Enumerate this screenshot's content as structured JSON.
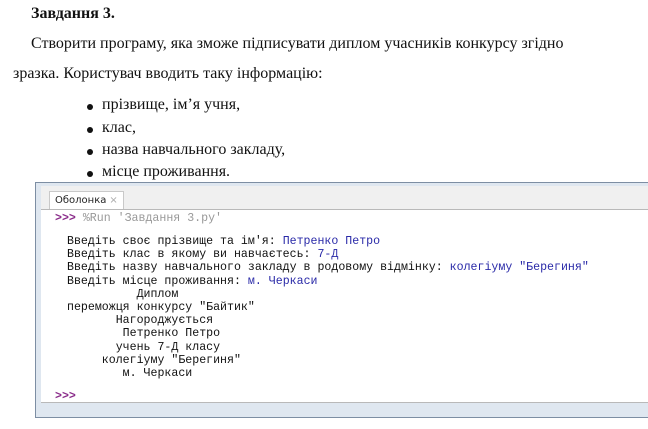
{
  "task": {
    "title": "Завдання 3.",
    "para1": "Створити програму, яка зможе підписувати диплом учасників конкурсу згідно",
    "para2": "зразка. Користувач вводить таку інформацію:",
    "bullets": [
      "прізвище, ім’я учня,",
      "клас,",
      "назва навчального закладу,",
      "місце проживання."
    ]
  },
  "shell": {
    "tab_label": "Оболонка",
    "tab_close": "×",
    "prompt": ">>>",
    "command": "%Run 'Завдання 3.py'",
    "inputs": [
      {
        "q": "Введіть своє прізвище та ім'я: ",
        "a": "Петренко Петро"
      },
      {
        "q": "Введіть клас в якому ви навчаєтесь: ",
        "a": "7-Д"
      },
      {
        "q": "Введіть назву навчального закладу в родовому відмінку: ",
        "a": "колегіуму \"Берегиня\""
      },
      {
        "q": "Введіть місце проживання: ",
        "a": "м. Черкаси"
      }
    ],
    "output": [
      "          Диплом",
      "переможця конкурсу \"Байтик\"",
      "       Нагороджується",
      "        Петренко Петро",
      "       учень 7-Д класу",
      "     колегіуму \"Берегиня\"",
      "        м. Черкаси"
    ]
  }
}
